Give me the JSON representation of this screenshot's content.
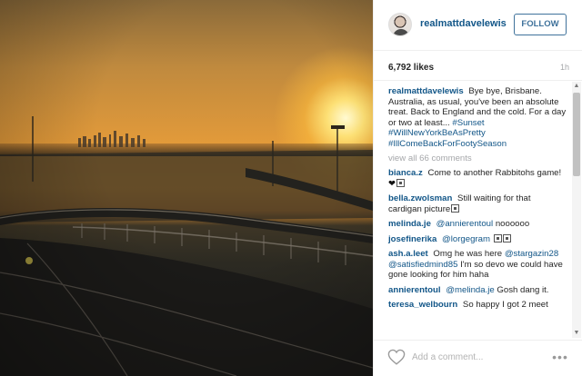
{
  "post": {
    "username": "realmattdavelewis",
    "follow_label": "FOLLOW",
    "likes": "6,792 likes",
    "age": "1h",
    "caption": {
      "author": "realmattdavelewis",
      "text": "Bye bye, Brisbane. Australia, as usual, you've been an absolute treat. Back to England and the cold. For a day or two at least...",
      "tags": [
        "#Sunset",
        "#WillNewYorkBeAsPretty",
        "#IllComeBackForFootySeason"
      ]
    },
    "view_all_comments": "view all 66 comments",
    "comments": [
      {
        "author": "bianca.z",
        "text": "Come to another Rabbitohs game!",
        "suffix_heart": "❤"
      },
      {
        "author": "bella.zwolsman",
        "text": "Still waiting for that cardigan picture"
      },
      {
        "author": "melinda.je",
        "mention": "@annierentoul",
        "text": "noooooo"
      },
      {
        "author": "josefinerika",
        "mention": "@lorgegram",
        "text": ""
      },
      {
        "author": "ash.a.leet",
        "text": "Omg he was here",
        "mention": "@stargazin28 @satisfiedmind85",
        "text2": "I'm so devo we could have gone looking for him haha"
      },
      {
        "author": "annierentoul",
        "mention": "@melinda.je",
        "text": "Gosh dang it."
      },
      {
        "author": "teresa_welbourn",
        "text": "So happy I got 2 meet"
      }
    ],
    "add_comment_placeholder": "Add a comment...",
    "more_label": "•••"
  },
  "icons": {
    "like": "heart-outline-icon",
    "more": "more-options-icon",
    "scroll_up": "scroll-up-arrow-icon",
    "scroll_down": "scroll-down-arrow-icon"
  },
  "colors": {
    "link": "#125688",
    "follow": "#3f729b",
    "muted": "#a5a7aa"
  }
}
